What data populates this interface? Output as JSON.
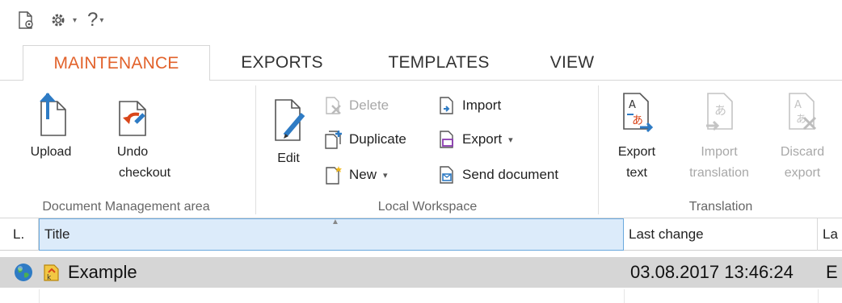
{
  "qat": {
    "icons": [
      "new-document-icon",
      "settings-gear-icon",
      "help-icon"
    ],
    "help_label": "?",
    "caret": "▾"
  },
  "tabs": [
    {
      "label": "MAINTENANCE",
      "active": true
    },
    {
      "label": "EXPORTS",
      "active": false
    },
    {
      "label": "TEMPLATES",
      "active": false
    },
    {
      "label": "VIEW",
      "active": false
    }
  ],
  "ribbon": {
    "doc_mgmt": {
      "label": "Document Management area",
      "upload": "Upload",
      "undo_line1": "Undo",
      "undo_line2": "checkout"
    },
    "local": {
      "label": "Local Workspace",
      "edit": "Edit",
      "delete": "Delete",
      "duplicate": "Duplicate",
      "new": "New",
      "import": "Import",
      "export": "Export",
      "send": "Send document",
      "dropdown": "▾"
    },
    "translation": {
      "label": "Translation",
      "export_line1": "Export",
      "export_line2": "text",
      "import_line1": "Import",
      "import_line2": "translation",
      "discard_line1": "Discard",
      "discard_line2": "export"
    }
  },
  "grid": {
    "columns": [
      "L.",
      "Title",
      "Last change",
      "La"
    ],
    "sort_indicator": "▲",
    "rows": [
      {
        "title": "Example",
        "last_change": "03.08.2017 13:46:24",
        "next": "E"
      }
    ]
  },
  "colors": {
    "accent": "#e2622b",
    "selected_header": "#dcebfa",
    "row_selected": "#d6d6d6",
    "icon_blue": "#2e7bc4"
  }
}
